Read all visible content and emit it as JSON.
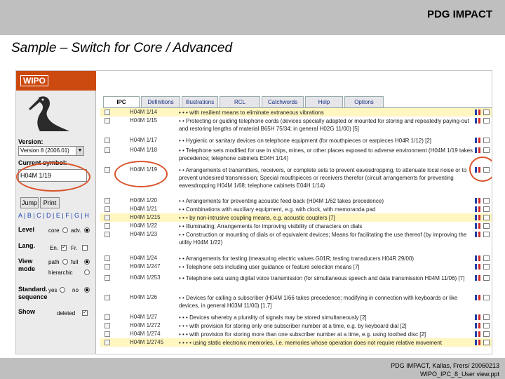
{
  "header": {
    "brand": "PDG IMPACT"
  },
  "slide": {
    "title": "Sample – Switch for Core / Advanced"
  },
  "footer": {
    "line1": "PDG IMPACT, Kallas, Frers/ 20060213",
    "line2": "WIPO_IPC_8_User view.ppt"
  },
  "wipo": {
    "logo": "WIPO",
    "version_label": "Version:",
    "version_value": "Version 8 (2006.01)",
    "symbol_label": "Current symbol:",
    "symbol_value": "H04M 1/19",
    "jump_button": "Jump",
    "print_button": "Print",
    "letters": "A | B | C | D | E | F | G | H",
    "level_label": "Level",
    "level_core": "core",
    "level_adv": "adv.",
    "lang_label": "Lang.",
    "lang_en": "En.",
    "lang_fr": "Fr.",
    "view_label": "View mode",
    "view_path": "path",
    "view_full": "full",
    "view_hier": "hierarchic",
    "std_label": "Standard. sequence",
    "std_yes": "yes",
    "std_no": "no",
    "show_label": "Show",
    "show_deleted": "deleted",
    "tabs": [
      "IPC",
      "Definitions",
      "Illustrations",
      "RCL",
      "Catchwords",
      "Help",
      "Options"
    ],
    "colors": {
      "accent": "#cc4a10",
      "highlight": "#fff6c0",
      "link": "#1a3fb0",
      "ring": "#d9532a"
    },
    "rows": [
      {
        "code": "H04M 1/14",
        "hl": true,
        "desc": "• • • with resilient means to eliminate extraneous vibrations"
      },
      {
        "code": "H04M 1/15",
        "hl": false,
        "desc": "• • Protecting or guiding telephone cords (devices specially adapted or mounted for storing and repeatedly paying-out and restoring lengths of material B65H 75/34; in general H02G 11/00) [5]"
      },
      {
        "code": "H04M 1/17",
        "hl": false,
        "desc": "• • Hygienic or sanitary devices on telephone equipment (for mouthpieces or earpieces H04R 1/12) [2]"
      },
      {
        "code": "H04M 1/18",
        "hl": false,
        "desc": "• • Telephone sets modified for use in ships, mines, or other places exposed to adverse environment (H04M 1/19 takes precedence; telephone cabinets E04H 1/14)"
      },
      {
        "code": "H04M 1/19",
        "hl": false,
        "desc": "• • Arrangements of transmitters, receivers, or complete sets to prevent eavesdropping, to attenuate local noise or to prevent undesired transmission; Special mouthpieces or receivers therefor (circuit arrangements for preventing eavesdropping H04M 1/68; telephone cabinets E04H 1/14)"
      },
      {
        "code": "H04M 1/20",
        "hl": false,
        "desc": "• • Arrangements for preventing acoustic feed-back (H04M 1/62 takes precedence)"
      },
      {
        "code": "H04M 1/21",
        "hl": false,
        "desc": "• • Combinations with auxiliary equipment, e.g. with clock, with memoranda pad"
      },
      {
        "code": "H04M 1/215",
        "hl": true,
        "desc": "• • • by non-intrusive coupling means, e.g. acoustic couplers [7]"
      },
      {
        "code": "H04M 1/22",
        "hl": false,
        "desc": "• • Illuminating; Arrangements for improving visibility of characters on dials"
      },
      {
        "code": "H04M 1/23",
        "hl": false,
        "desc": "• • Construction or mounting of dials or of equivalent devices; Means for facilitating the use thereof (by improving the utility H04M 1/22)"
      },
      {
        "code": "H04M 1/24",
        "hl": false,
        "desc": "• • Arrangements for testing (measuring electric values G01R; testing transducers H04R 29/00)"
      },
      {
        "code": "H04M 1/247",
        "hl": false,
        "desc": "• • Telephone sets including user guidance or feature selection means [7]"
      },
      {
        "code": "H04M 1/253",
        "hl": false,
        "desc": "• • Telephone sets using digital voice transmission (for simultaneous speech and data transmission H04M 11/06) [7]"
      },
      {
        "code": "H04M 1/26",
        "hl": false,
        "desc": "• • Devices for calling a subscriber (H04M 1/66 takes precedence; modifying in connection with keyboards or like devices, in general H03M 11/00) [1,7]"
      },
      {
        "code": "H04M 1/27",
        "hl": false,
        "desc": "• • • Devices whereby a plurality of signals may be stored simultaneously [2]"
      },
      {
        "code": "H04M 1/272",
        "hl": false,
        "desc": "• • • with provision for storing only one subscriber number at a time, e.g. by keyboard dial [2]"
      },
      {
        "code": "H04M 1/274",
        "hl": false,
        "desc": "• • • with provision for storing more than one subscriber number at a time, e.g. using toothed disc [2]"
      },
      {
        "code": "H04M 1/2745",
        "hl": true,
        "desc": "• • • • using static electronic memories, i.e. memories whose operation does not require relative movement"
      }
    ]
  }
}
